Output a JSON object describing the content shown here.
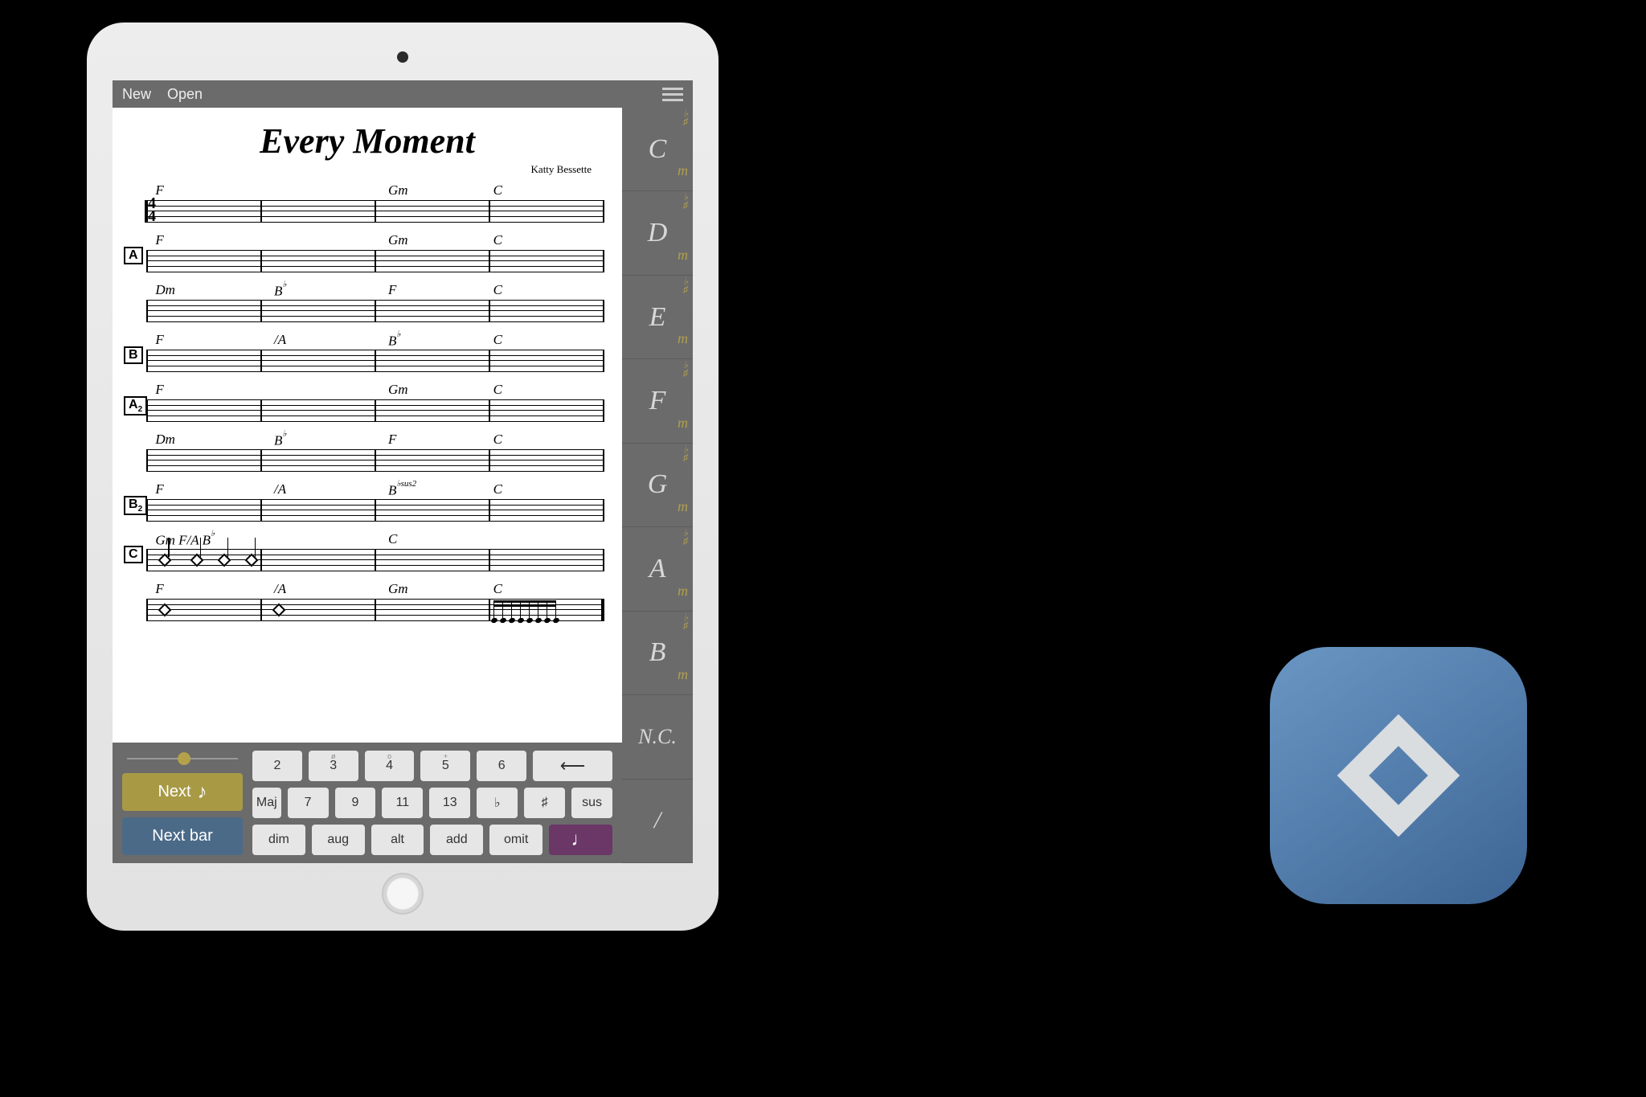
{
  "topbar": {
    "new": "New",
    "open": "Open"
  },
  "song": {
    "title": "Every Moment",
    "byline": "Katty Bessette",
    "timesig_top": "4",
    "timesig_bottom": "4",
    "rows": [
      {
        "section": "",
        "chords": [
          "F",
          "",
          "Gm",
          "C"
        ],
        "first": true
      },
      {
        "section": "A",
        "chords": [
          "F",
          "",
          "Gm",
          "C"
        ]
      },
      {
        "section": "",
        "chords": [
          "Dm",
          "B♭",
          "F",
          "C"
        ]
      },
      {
        "section": "B",
        "chords": [
          "F",
          "/A",
          "B♭",
          "C"
        ]
      },
      {
        "section": "A2",
        "chords": [
          "F",
          "",
          "Gm",
          "C"
        ]
      },
      {
        "section": "",
        "chords": [
          "Dm",
          "B♭",
          "F",
          "C"
        ]
      },
      {
        "section": "B2",
        "chords": [
          "F",
          "/A",
          "B♭sus2",
          "C"
        ]
      },
      {
        "section": "C",
        "chords": [
          "Gm   F/A B♭",
          "",
          "C",
          ""
        ],
        "rhythm": "diamonds"
      },
      {
        "section": "",
        "chords": [
          "F",
          "/A",
          "Gm",
          "C"
        ],
        "rhythm": "end"
      }
    ]
  },
  "sidebar": {
    "roots": [
      "C",
      "D",
      "E",
      "F",
      "G",
      "A",
      "B"
    ],
    "nc": "N.C.",
    "slash": "/",
    "sharp": "♯",
    "flat": "♭",
    "m": "m"
  },
  "kbd": {
    "next": "Next",
    "nextbar": "Next bar",
    "row1_sup": [
      "",
      "",
      "ø",
      "o",
      "+",
      ""
    ],
    "row1": [
      "2",
      "3",
      "4",
      "5",
      "6"
    ],
    "backspace": "⟵",
    "row2_left": "Maj",
    "row2": [
      "7",
      "9",
      "11",
      "13",
      "♭",
      "♯",
      "sus"
    ],
    "row3": [
      "dim",
      "aug",
      "alt",
      "add",
      "omit"
    ]
  },
  "app_icon_color": "#4f78a8"
}
